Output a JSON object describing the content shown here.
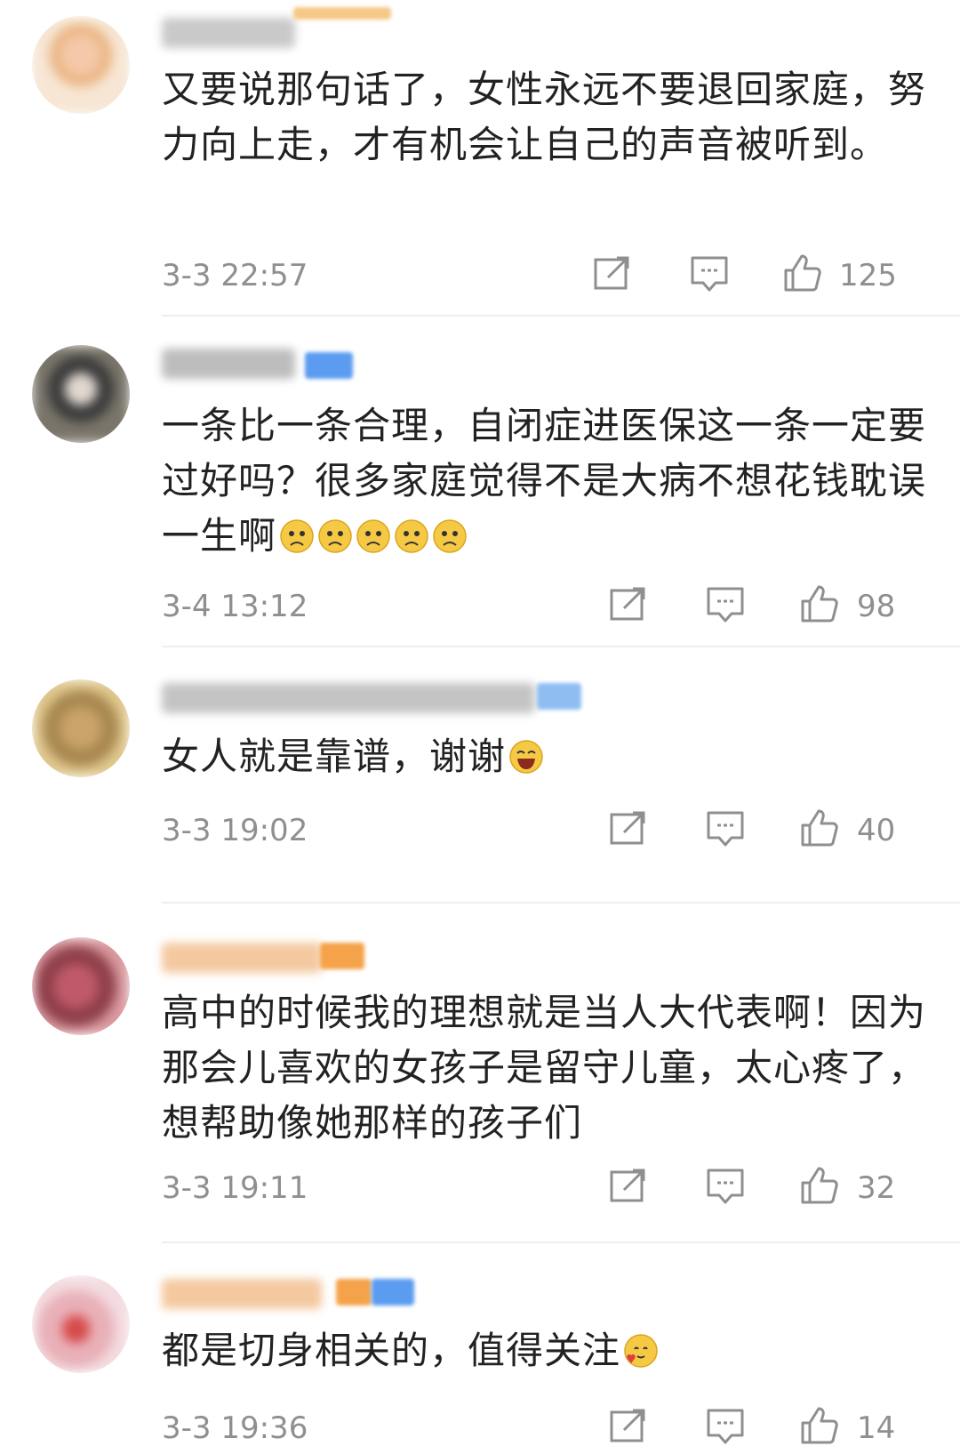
{
  "colors": {
    "text": "#222222",
    "meta": "#8f8f8f",
    "divider": "#eeeeee",
    "badge_blue": "#5b9cf0",
    "badge_orange": "#f5a34a"
  },
  "icons": {
    "share": "share-icon",
    "comment": "comment-icon",
    "like": "thumb-up-icon"
  },
  "comments": [
    {
      "text": "又要说那句话了，女性永远不要退回家庭，努力向上走，才有机会让自己的声音被听到。",
      "time": "3-3 22:57",
      "likes": "125",
      "emojis": []
    },
    {
      "text": "一条比一条合理，自闭症进医保这一条一定要过好吗？很多家庭觉得不是大病不想花钱耽误一生啊",
      "time": "3-4 13:12",
      "likes": "98",
      "emojis": [
        "sad-face-emoji",
        "sad-face-emoji",
        "sad-face-emoji",
        "sad-face-emoji",
        "sad-face-emoji"
      ]
    },
    {
      "text": "女人就是靠谱，谢谢",
      "time": "3-3 19:02",
      "likes": "40",
      "emojis": [
        "laughing-face-emoji"
      ]
    },
    {
      "text": "高中的时候我的理想就是当人大代表啊！因为那会儿喜欢的女孩子是留守儿童，太心疼了，想帮助像她那样的孩子们",
      "time": "3-3 19:11",
      "likes": "32",
      "emojis": []
    },
    {
      "text": "都是切身相关的，值得关注",
      "time": "3-3 19:36",
      "likes": "14",
      "emojis": [
        "heart-face-emoji"
      ]
    }
  ]
}
